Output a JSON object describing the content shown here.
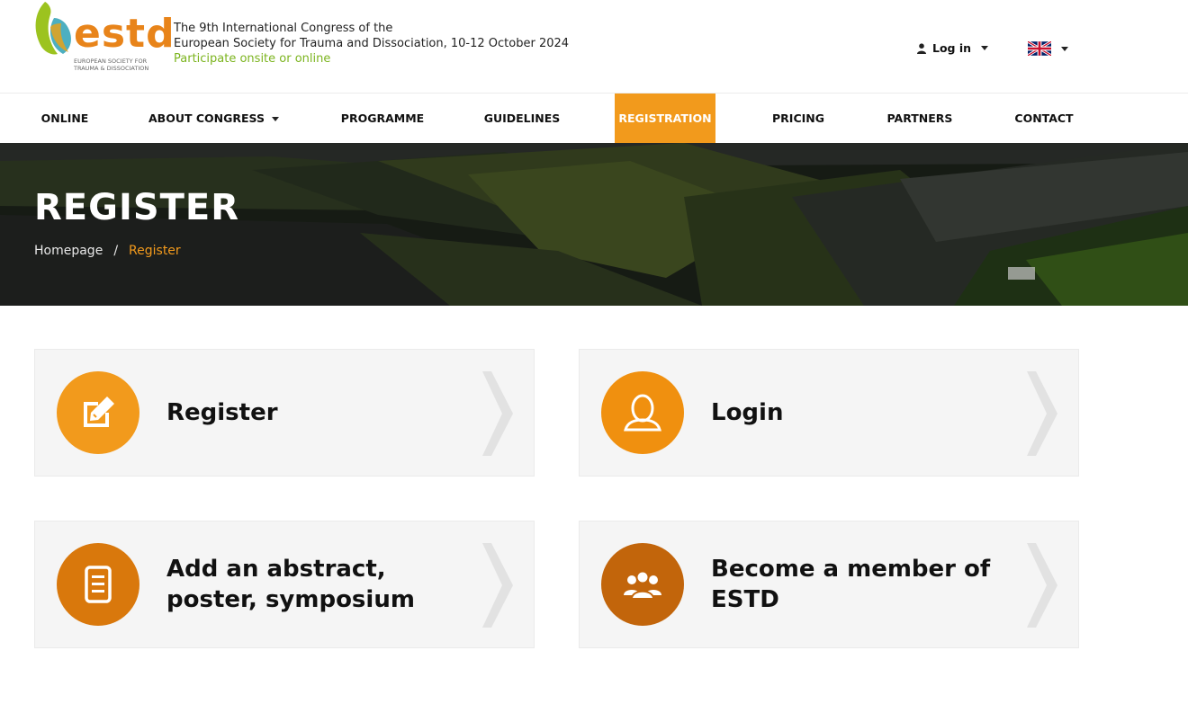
{
  "header": {
    "logo_text": "estd",
    "logo_subtitle_line1": "EUROPEAN SOCIETY FOR",
    "logo_subtitle_line2": "TRAUMA & DISSOCIATION",
    "tagline_line1": "The 9th International Congress of the",
    "tagline_line2": "European Society for Trauma and Dissociation, 10-12 October 2024",
    "tagline_line3": "Participate onsite or online",
    "login_label": "Log in",
    "language_icon": "uk-flag-icon"
  },
  "nav": {
    "items": [
      {
        "label": "ONLINE"
      },
      {
        "label": "ABOUT CONGRESS"
      },
      {
        "label": "PROGRAMME"
      },
      {
        "label": "GUIDELINES"
      },
      {
        "label": "REGISTRATION"
      },
      {
        "label": "PRICING"
      },
      {
        "label": "PARTNERS"
      },
      {
        "label": "CONTACT"
      }
    ],
    "active": "REGISTRATION"
  },
  "hero": {
    "title": "REGISTER",
    "breadcrumb": {
      "home": "Homepage",
      "separator": "/",
      "current": "Register"
    }
  },
  "cards": [
    {
      "label": "Register",
      "icon": "edit-icon",
      "color": "#f29a1c"
    },
    {
      "label": "Login",
      "icon": "user-icon",
      "color": "#f0900f"
    },
    {
      "label": "Add an abstract, poster, symposium",
      "icon": "document-icon",
      "color": "#d9780c"
    },
    {
      "label": "Become a member of ESTD",
      "icon": "group-icon",
      "color": "#c2650b"
    }
  ],
  "colors": {
    "accent": "#f29a1c",
    "logo_orange": "#e8841a",
    "logo_green": "#7cb41f"
  }
}
